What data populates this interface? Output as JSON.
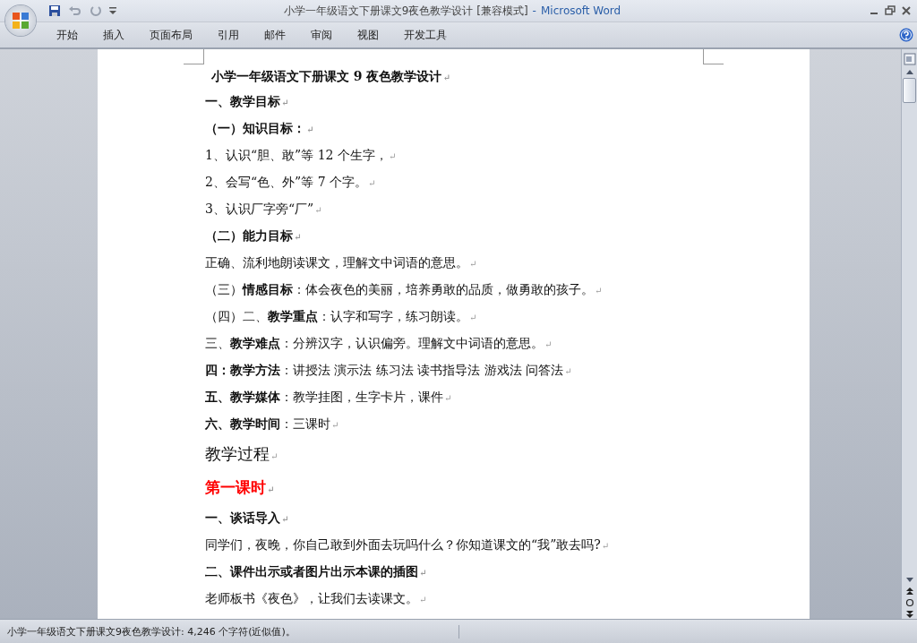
{
  "window": {
    "title": "小学一年级语文下册课文9夜色教学设计 [兼容模式]",
    "app_name": "Microsoft Word",
    "separator": "-"
  },
  "ribbon_tabs": [
    {
      "label": "开始",
      "selected": false
    },
    {
      "label": "插入",
      "selected": false
    },
    {
      "label": "页面布局",
      "selected": false
    },
    {
      "label": "引用",
      "selected": false
    },
    {
      "label": "邮件",
      "selected": false
    },
    {
      "label": "审阅",
      "selected": false
    },
    {
      "label": "视图",
      "selected": false
    },
    {
      "label": "开发工具",
      "selected": false
    }
  ],
  "document": {
    "para_mark": "↵",
    "paragraphs": [
      {
        "kind": "title",
        "text": "小学一年级语文下册课文 9 夜色教学设计"
      },
      {
        "kind": "heading",
        "text": "一、教学目标"
      },
      {
        "kind": "heading",
        "text": "（一）知识目标："
      },
      {
        "kind": "body",
        "text": "1、认识“胆、敢”等 12 个生字，"
      },
      {
        "kind": "body",
        "text": "2、会写“色、外”等 7 个字。"
      },
      {
        "kind": "body",
        "text": "3、认识厂字旁“厂”"
      },
      {
        "kind": "heading",
        "text": "（二）能力目标"
      },
      {
        "kind": "body",
        "text": " 正确、流利地朗读课文，理解文中词语的意思。"
      },
      {
        "kind": "body",
        "text": "（三）**情感目标**：体会夜色的美丽，培养勇敢的品质，做勇敢的孩子。"
      },
      {
        "kind": "body",
        "text": "（四）二、**教学重点**：认字和写字，练习朗读。"
      },
      {
        "kind": "body",
        "text": "三、**教学难点**：分辨汉字，认识偏旁。理解文中词语的意思。"
      },
      {
        "kind": "body",
        "text": "**四：教学方法**：讲授法 演示法  练习法  读书指导法  游戏法  问答法"
      },
      {
        "kind": "body",
        "text": "**五、教学媒体**：教学挂图，生字卡片，课件"
      },
      {
        "kind": "body",
        "text": "**六、教学时间**：三课时"
      },
      {
        "kind": "section",
        "text": "教学过程"
      },
      {
        "kind": "lesson",
        "text": "第一课时"
      },
      {
        "kind": "heading",
        "text": "一、谈话导入"
      },
      {
        "kind": "body",
        "text": "同学们，夜晚，你自己敢到外面去玩吗什么？你知道课文的“我”敢去吗?"
      },
      {
        "kind": "heading",
        "text": "二、课件出示或者图片出示本课的插图"
      },
      {
        "kind": "body",
        "text": "老师板书《夜色》，让我们去读课文。"
      }
    ]
  },
  "status_bar": {
    "text": "小学一年级语文下册课文9夜色教学设计: 4,246 个字符(近似值)。"
  }
}
